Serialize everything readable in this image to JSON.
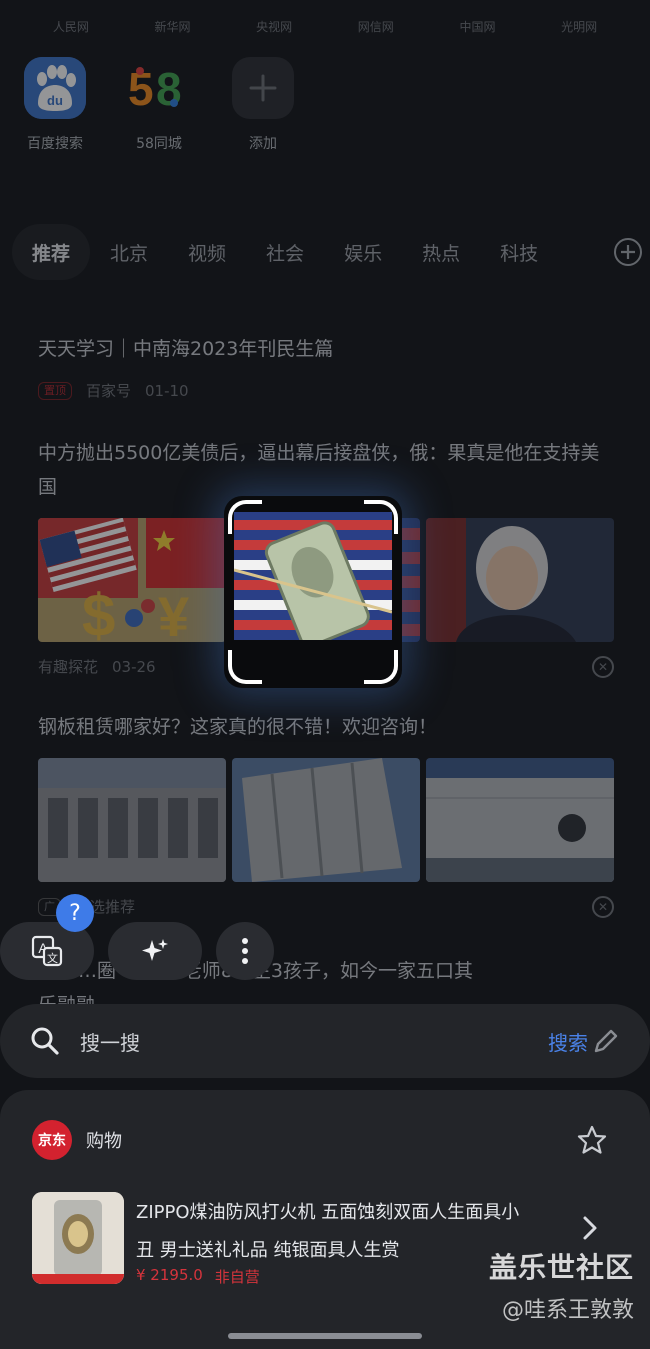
{
  "site_links": [
    "人民网",
    "新华网",
    "央视网",
    "网信网",
    "中国网",
    "光明网"
  ],
  "shortcuts": [
    {
      "label": "百度搜索",
      "icon": "baidu-paw-icon",
      "glyph": "du"
    },
    {
      "label": "58同城",
      "icon": "58-logo-icon",
      "glyph": "58"
    },
    {
      "label": "添加",
      "icon": "plus-icon",
      "glyph": "+"
    }
  ],
  "tabs": [
    "推荐",
    "北京",
    "视频",
    "社会",
    "娱乐",
    "热点",
    "科技"
  ],
  "feed": {
    "item1": {
      "headline": "天天学习｜中南海2023年刊民生篇",
      "tag": "置顶",
      "source": "百家号",
      "date": "01-10"
    },
    "item2": {
      "headline": "中方抛出5500亿美债后，逼出幕后接盘侠，俄：果真是他在支持美国",
      "source": "有趣探花",
      "date": "03-26"
    },
    "item3": {
      "headline": "钢板租赁哪家好？这家真的很不错！欢迎咨询！",
      "source": "精选推荐",
      "ad_mark": "广"
    },
    "item4": {
      "headline": "…圈“…恋…老师8年生3孩子，如今一家五口其",
      "tail": "乐融融"
    }
  },
  "toolbar": {
    "help": "?",
    "translate_icon": "translate-icon",
    "sparkle_icon": "sparkle-icon",
    "more_icon": "more-vertical-icon"
  },
  "search": {
    "placeholder": "搜一搜",
    "button": "搜索"
  },
  "shop": {
    "brand": "京东",
    "title": "购物",
    "product_title": "ZIPPO煤油防风打火机 五面蚀刻双面人生面具小丑 男士送礼礼品 纯银面具人生赏",
    "price": "¥ 2195.0",
    "seller_type": "非自营"
  },
  "watermark": {
    "line1": "盖乐世社区",
    "line2": "@哇系王敦敦"
  },
  "colors": {
    "accent_blue": "#4a82e8",
    "jd_red": "#d3222f",
    "price_red": "#d5343c",
    "background": "#121418"
  }
}
